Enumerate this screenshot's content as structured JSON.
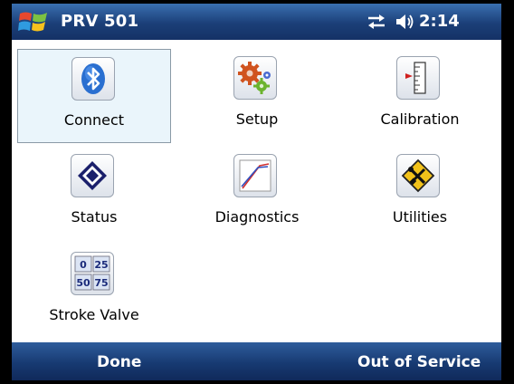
{
  "titlebar": {
    "app_title": "PRV 501",
    "clock": "2:14",
    "icons": [
      "windows-start-icon",
      "sync-icon",
      "volume-icon"
    ]
  },
  "menu": {
    "items": [
      {
        "label": "Connect",
        "icon": "bluetooth-icon",
        "selected": true
      },
      {
        "label": "Setup",
        "icon": "gears-icon",
        "selected": false
      },
      {
        "label": "Calibration",
        "icon": "calibration-scale-icon",
        "selected": false
      },
      {
        "label": "Status",
        "icon": "status-diamond-icon",
        "selected": false
      },
      {
        "label": "Diagnostics",
        "icon": "diagnostics-chart-icon",
        "selected": false
      },
      {
        "label": "Utilities",
        "icon": "utilities-tools-icon",
        "selected": false
      },
      {
        "label": "Stroke Valve",
        "icon": "stroke-valve-icon",
        "selected": false
      }
    ],
    "stroke_valve_values": [
      "0",
      "25",
      "50",
      "75"
    ]
  },
  "softkeys": {
    "left": "Done",
    "right": "Out of Service"
  },
  "colors": {
    "titlebar": "#1b3f78",
    "selection_bg": "#eaf5fb",
    "bluetooth": "#2a6fd0",
    "status_diamond": "#1a1f6b",
    "utilities_yellow": "#f2c21a"
  }
}
